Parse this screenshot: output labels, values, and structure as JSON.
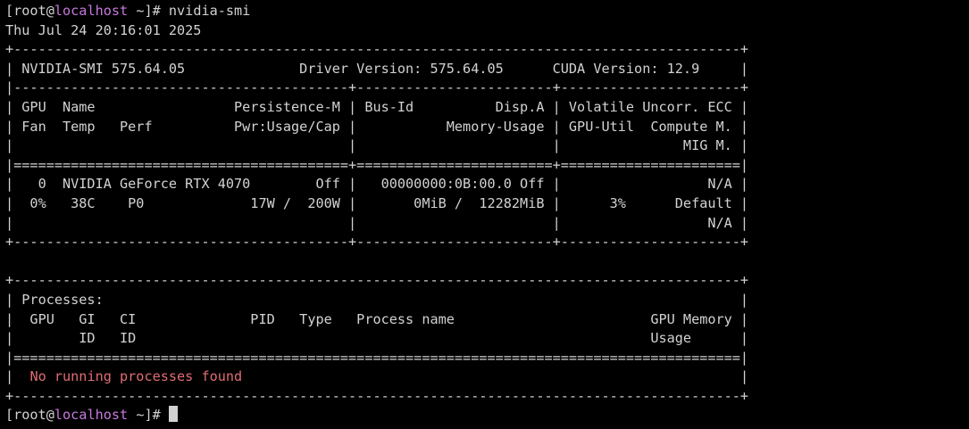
{
  "colors": {
    "background": "#000000",
    "text": "#d2d2d2",
    "hostname": "#c678dd",
    "no_process_message": "#e06c75"
  },
  "prompt": {
    "prefix": "[root@",
    "host": "localhost",
    "suffix": " ~]# ",
    "command": "nvidia-smi"
  },
  "timestamp": "Thu Jul 24 20:16:01 2025",
  "smi_output": {
    "border_top": "+-----------------------------------------------------------------------------------------+",
    "version_line": "| NVIDIA-SMI 575.64.05              Driver Version: 575.64.05      CUDA Version: 12.9     |",
    "divider_gpu_top": "|-----------------------------------------+------------------------+----------------------+",
    "gpu_header_1": "| GPU  Name                 Persistence-M | Bus-Id          Disp.A | Volatile Uncorr. ECC |",
    "gpu_header_2": "| Fan  Temp   Perf          Pwr:Usage/Cap |           Memory-Usage | GPU-Util  Compute M. |",
    "gpu_header_3": "|                                         |                        |               MIG M. |",
    "divider_double": "|=========================================+========================+======================|",
    "gpu_row_1": "|   0  NVIDIA GeForce RTX 4070        Off |   00000000:0B:00.0 Off |                  N/A |",
    "gpu_row_2": "|  0%   38C    P0             17W /  200W |       0MiB /  12282MiB |      3%      Default |",
    "gpu_row_3": "|                                         |                        |                  N/A |",
    "gpu_bottom": "+-----------------------------------------+------------------------+----------------------+",
    "blank": "",
    "proc_top": "+-----------------------------------------------------------------------------------------+",
    "proc_title": "| Processes:                                                                              |",
    "proc_header_1": "|  GPU   GI   CI              PID   Type   Process name                        GPU Memory |",
    "proc_header_2": "|        ID   ID                                                               Usage      |",
    "proc_divider": "|=========================================================================================|",
    "proc_empty_lead": "|  ",
    "proc_empty_msg": "No running processes found",
    "proc_empty_trail": "                                                             |",
    "proc_bottom": "+-----------------------------------------------------------------------------------------+"
  },
  "final_prompt": {
    "prefix": "[root@",
    "host": "localhost",
    "suffix": " ~]# "
  }
}
